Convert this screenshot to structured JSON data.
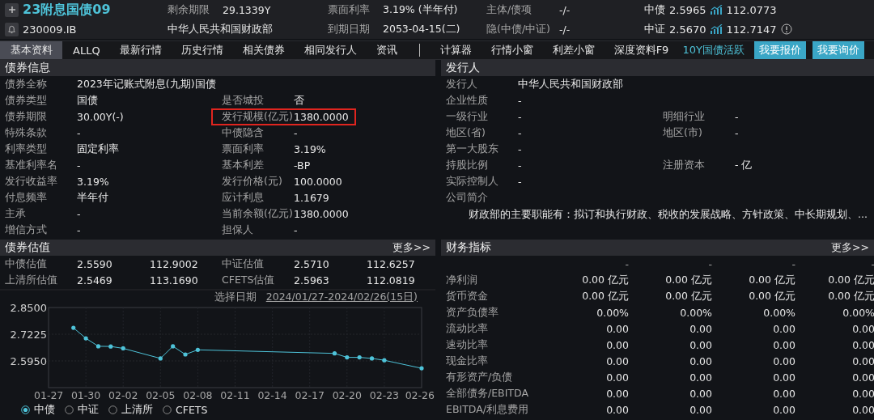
{
  "header": {
    "title": "23附息国债09",
    "code": "230009.IB",
    "issuer": "中华人民共和国财政部",
    "row1": [
      {
        "label": "剩余期限",
        "value": "29.1339Y"
      },
      {
        "label": "票面利率",
        "value": "3.19% (半年付)"
      },
      {
        "label": "主体/债项",
        "value": "-/-"
      }
    ],
    "row2": [
      {
        "label": "到期日期",
        "value": "2053-04-15(二)"
      },
      {
        "label": "隐(中债/中证)",
        "value": "-/-"
      }
    ],
    "quotes": [
      {
        "source": "中债",
        "yield": "2.5965",
        "price": "112.0773",
        "alert": false
      },
      {
        "source": "中证",
        "yield": "2.5670",
        "price": "112.7147",
        "alert": true
      }
    ]
  },
  "tabs": [
    {
      "label": "基本资料",
      "kind": "tab",
      "selected": true
    },
    {
      "label": "ALLQ",
      "kind": "tab",
      "selected": false
    },
    {
      "label": "最新行情",
      "kind": "tab",
      "selected": false
    },
    {
      "label": "历史行情",
      "kind": "tab",
      "selected": false
    },
    {
      "label": "相关债券",
      "kind": "tab",
      "selected": false
    },
    {
      "label": "相同发行人",
      "kind": "tab",
      "selected": false
    },
    {
      "label": "资讯",
      "kind": "tab",
      "selected": false
    },
    {
      "label": "计算器",
      "kind": "tool",
      "selected": false
    },
    {
      "label": "行情小窗",
      "kind": "tool",
      "selected": false
    },
    {
      "label": "利差小窗",
      "kind": "tool",
      "selected": false
    },
    {
      "label": "深度资料F9",
      "kind": "tool",
      "selected": false
    },
    {
      "label": "10Y国债活跃",
      "kind": "link",
      "selected": false
    },
    {
      "label": "我要报价",
      "kind": "action",
      "selected": false
    },
    {
      "label": "我要询价",
      "kind": "action",
      "selected": false
    }
  ],
  "bond_info": {
    "title": "债券信息",
    "rows": [
      {
        "left": {
          "label": "债券全称",
          "value": "2023年记账式附息(九期)国债"
        }
      },
      {
        "left": {
          "label": "债券类型",
          "value": "国债"
        },
        "right": {
          "label": "是否城投",
          "value": "否",
          "highlighted": false
        }
      },
      {
        "left": {
          "label": "债券期限",
          "value": "30.00Y(-)"
        },
        "right": {
          "label": "发行规模(亿元)",
          "value": "1380.0000",
          "highlighted": true
        }
      },
      {
        "left": {
          "label": "特殊条款",
          "value": "-"
        },
        "right": {
          "label": "中债隐含",
          "value": "-",
          "highlighted": false
        }
      },
      {
        "left": {
          "label": "利率类型",
          "value": "固定利率"
        },
        "right": {
          "label": "票面利率",
          "value": "3.19%",
          "highlighted": false
        }
      },
      {
        "left": {
          "label": "基准利率名",
          "value": "-"
        },
        "right": {
          "label": "基本利差",
          "value": "-BP",
          "highlighted": false
        }
      },
      {
        "left": {
          "label": "发行收益率",
          "value": "3.19%"
        },
        "right": {
          "label": "发行价格(元)",
          "value": "100.0000",
          "highlighted": false
        }
      },
      {
        "left": {
          "label": "付息频率",
          "value": "半年付"
        },
        "right": {
          "label": "应计利息",
          "value": "1.1679",
          "highlighted": false
        }
      },
      {
        "left": {
          "label": "主承",
          "value": "-"
        },
        "right": {
          "label": "当前余额(亿元)",
          "value": "1380.0000",
          "highlighted": false
        }
      },
      {
        "left": {
          "label": "增信方式",
          "value": "-"
        },
        "right": {
          "label": "担保人",
          "value": "-",
          "highlighted": false
        }
      }
    ]
  },
  "issuer": {
    "title": "发行人",
    "rows": [
      {
        "left": {
          "label": "发行人",
          "value": "中华人民共和国财政部"
        }
      },
      {
        "left": {
          "label": "企业性质",
          "value": "-"
        }
      },
      {
        "left": {
          "label": "一级行业",
          "value": "-"
        },
        "right": {
          "label": "明细行业",
          "value": "-"
        }
      },
      {
        "left": {
          "label": "地区(省)",
          "value": "-"
        },
        "right": {
          "label": "地区(市)",
          "value": "-"
        }
      },
      {
        "left": {
          "label": "第一大股东",
          "value": "-"
        }
      },
      {
        "left": {
          "label": "持股比例",
          "value": "-"
        },
        "right": {
          "label": "注册资本",
          "value": "- 亿"
        }
      },
      {
        "left": {
          "label": "实际控制人",
          "value": "-"
        }
      },
      {
        "left": {
          "label": "公司简介"
        }
      }
    ],
    "profile": "财政部的主要职能有：拟订和执行财政、税收的发展战略、方针政策、中长期规划、..."
  },
  "valuation": {
    "title": "债券估值",
    "more": "更多>>",
    "rows": [
      {
        "cells": [
          "中债估值",
          "2.5590",
          "112.9002",
          "中证估值",
          "2.5710",
          "112.6257"
        ]
      },
      {
        "cells": [
          "上清所估值",
          "2.5469",
          "113.1690",
          "CFETS估值",
          "2.5963",
          "112.0819"
        ]
      }
    ],
    "date_label": "选择日期",
    "date_range": "2024/01/27-2024/02/26(15日)",
    "chart_data": {
      "type": "line",
      "categories": [
        "01-27",
        null,
        null,
        "01-30",
        null,
        null,
        "02-02",
        null,
        null,
        "02-05",
        null,
        null,
        "02-08",
        null,
        null,
        "02-11",
        null,
        null,
        "02-14",
        null,
        null,
        "02-17",
        null,
        null,
        "02-20",
        null,
        null,
        "02-23",
        null,
        null,
        "02-26"
      ],
      "grid": true,
      "series": [
        {
          "color": "#4ec3d9",
          "values": [
            null,
            null,
            2.753,
            2.703,
            2.665,
            2.664,
            2.655,
            null,
            null,
            2.607,
            2.665,
            2.626,
            2.648,
            null,
            null,
            null,
            null,
            null,
            null,
            null,
            null,
            null,
            null,
            2.631,
            2.612,
            2.612,
            2.607,
            2.598,
            null,
            null,
            2.56
          ]
        }
      ],
      "ylim": [
        2.4675,
        2.85
      ],
      "yticks": [
        {
          "value": 2.85,
          "label": "2.8500"
        },
        {
          "value": 2.7225,
          "label": "2.7225"
        },
        {
          "value": 2.595,
          "label": "2.5950"
        }
      ]
    },
    "sources": [
      {
        "label": "中债",
        "selected": true
      },
      {
        "label": "中证",
        "selected": false
      },
      {
        "label": "上清所",
        "selected": false
      },
      {
        "label": "CFETS",
        "selected": false
      }
    ]
  },
  "financials": {
    "title": "财务指标",
    "more": "更多>>",
    "columns": [
      "-",
      "-",
      "-",
      "-"
    ],
    "rows": [
      {
        "label": "净利润",
        "values": [
          "0.00 亿元",
          "0.00 亿元",
          "0.00 亿元",
          "0.00 亿元"
        ]
      },
      {
        "label": "货币资金",
        "values": [
          "0.00 亿元",
          "0.00 亿元",
          "0.00 亿元",
          "0.00 亿元"
        ]
      },
      {
        "label": "资产负债率",
        "values": [
          "0.00%",
          "0.00%",
          "0.00%",
          "0.00%"
        ]
      },
      {
        "label": "流动比率",
        "values": [
          "0.00",
          "0.00",
          "0.00",
          "0.00"
        ]
      },
      {
        "label": "速动比率",
        "values": [
          "0.00",
          "0.00",
          "0.00",
          "0.00"
        ]
      },
      {
        "label": "现金比率",
        "values": [
          "0.00",
          "0.00",
          "0.00",
          "0.00"
        ]
      },
      {
        "label": "有形资产/负债",
        "values": [
          "0.00",
          "0.00",
          "0.00",
          "0.00"
        ]
      },
      {
        "label": "全部债务/EBITDA",
        "values": [
          "0.00",
          "0.00",
          "0.00",
          "0.00"
        ]
      },
      {
        "label": "EBITDA/利息费用",
        "values": [
          "0.00",
          "0.00",
          "0.00",
          "0.00"
        ]
      }
    ]
  }
}
